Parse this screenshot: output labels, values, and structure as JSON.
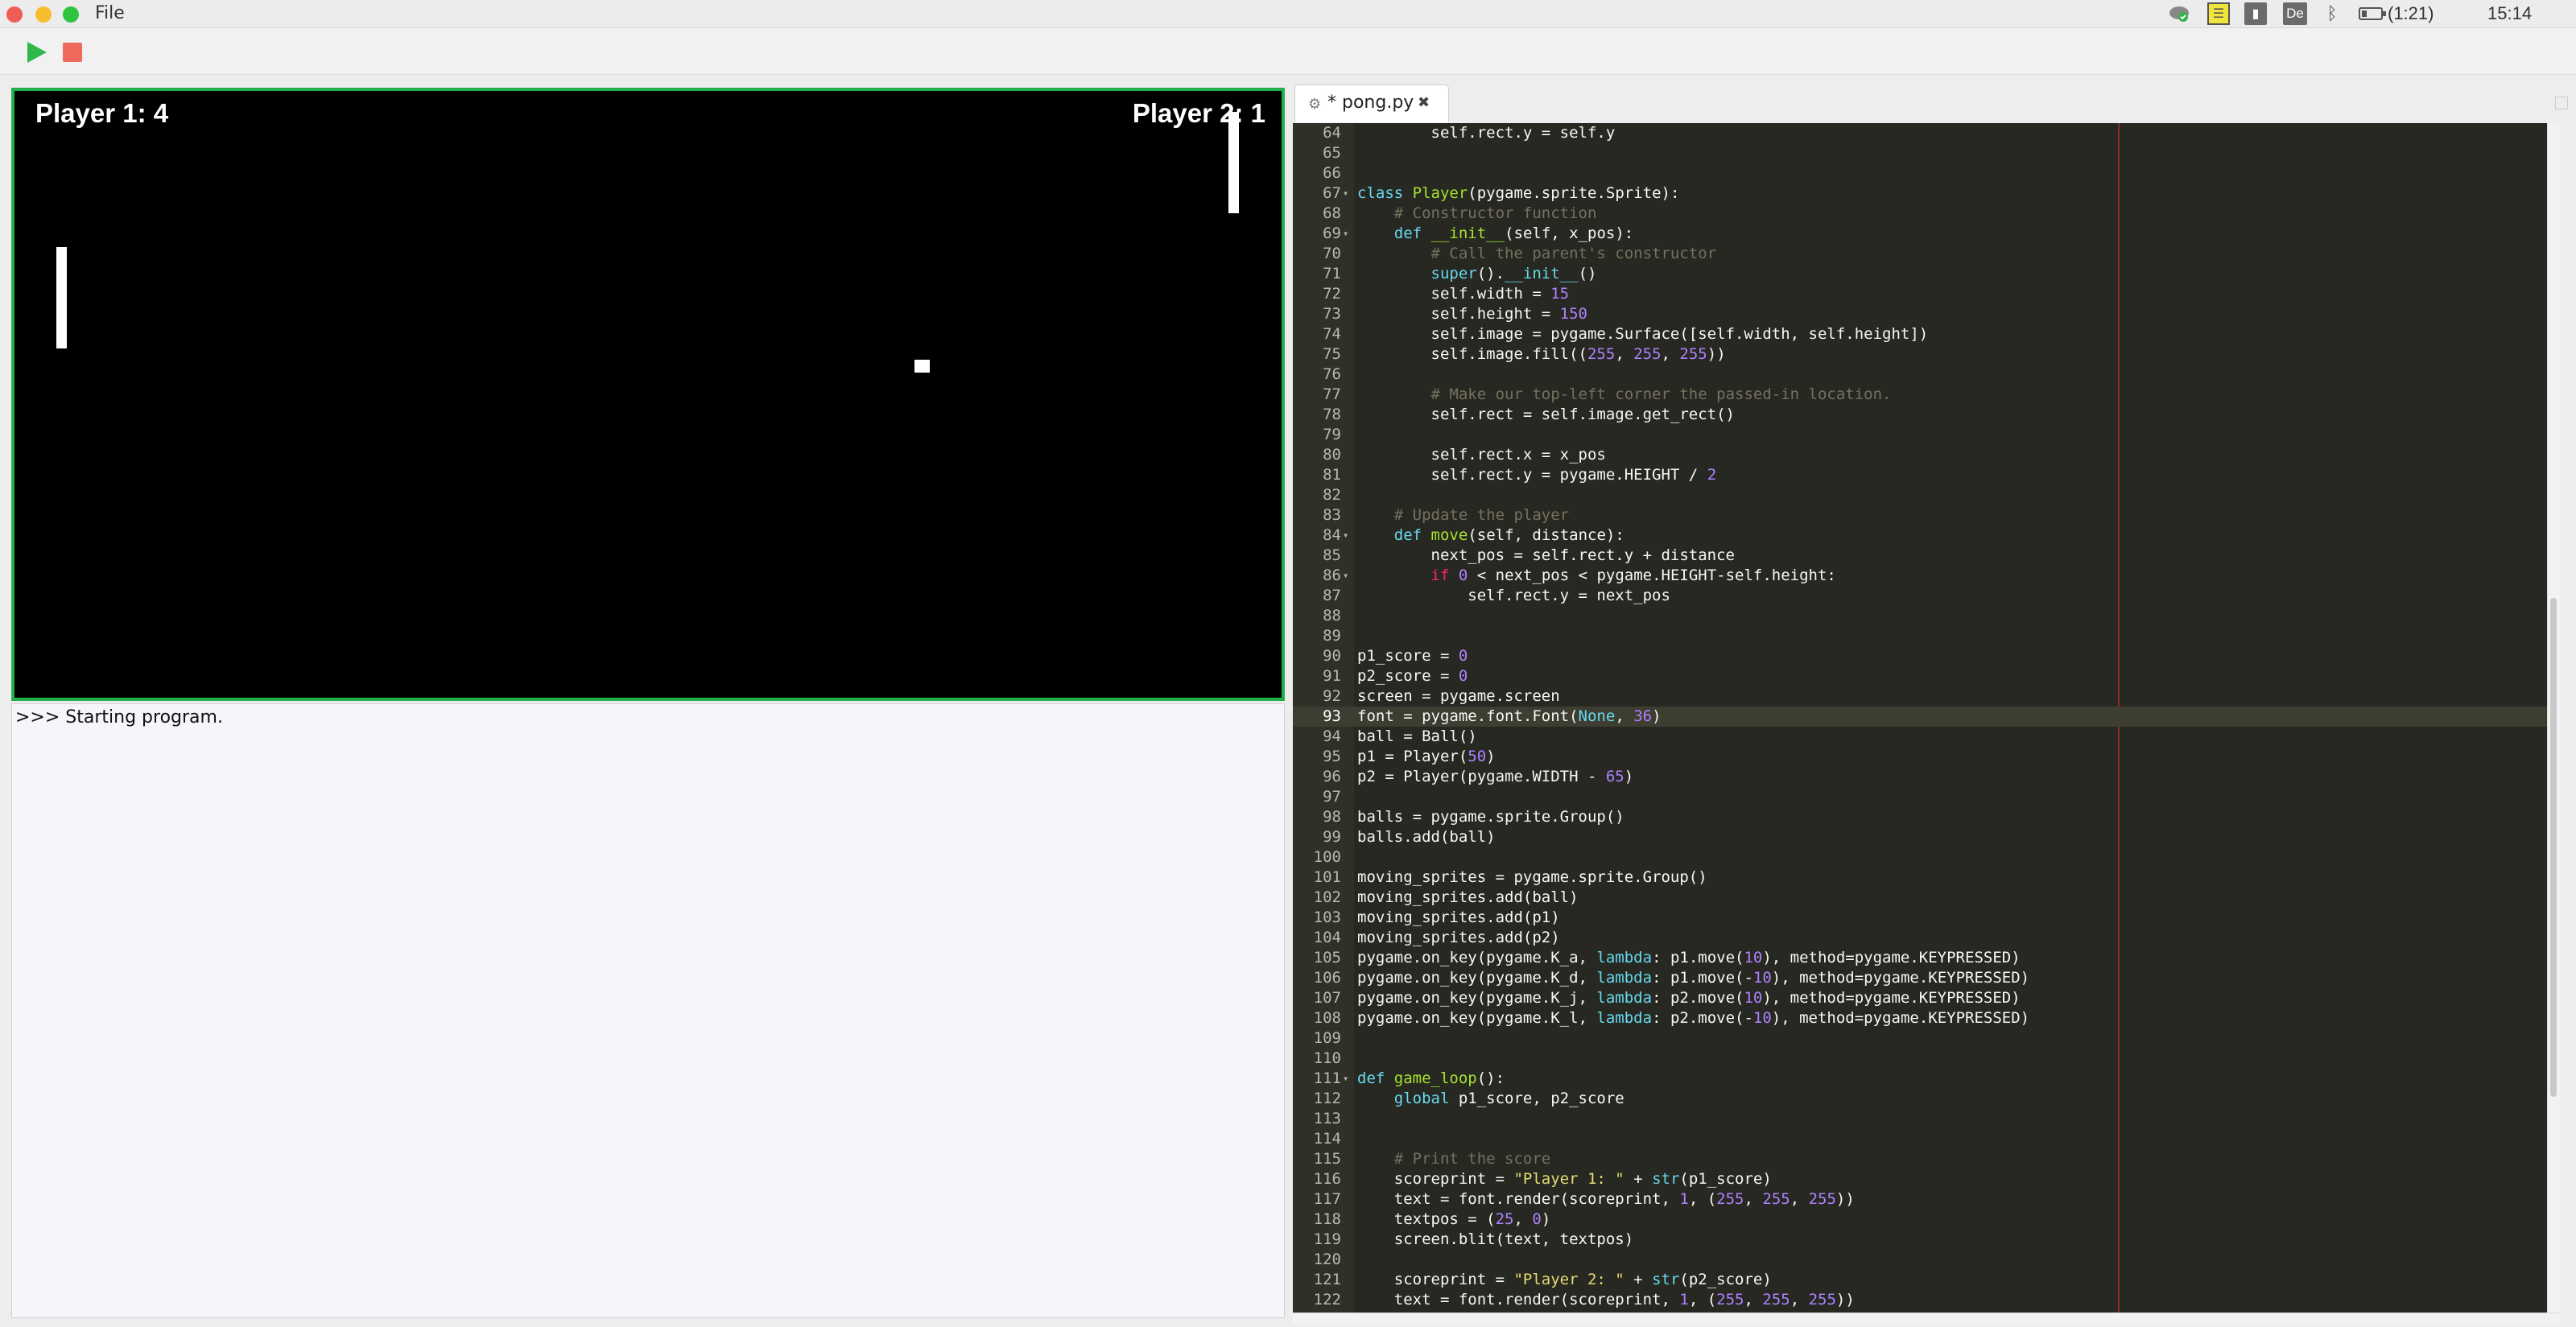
{
  "menubar": {
    "menu_file": "File",
    "tray_lang": "De",
    "battery_text": "(1:21)",
    "clock": "15:14"
  },
  "icons": {
    "cloud": "cloud-sync-icon",
    "notes": "sticky-notes-icon",
    "chart": "system-monitor-icon",
    "bluetooth": "bluetooth-icon",
    "battery": "battery-icon",
    "apple": "apple-logo-icon",
    "run": "play-icon",
    "stop": "stop-icon"
  },
  "colors": {
    "run": "#2eb84b",
    "stop": "#ef6a5c",
    "game_border": "#22b04b",
    "editor_bg": "#272822"
  },
  "game": {
    "score_left": "Player 1: 4",
    "score_right": "Player 2: 1"
  },
  "console": {
    "output": ">>> Starting program."
  },
  "editor": {
    "tab_label": "* pong.py",
    "current_line": 93,
    "lines": [
      {
        "n": 64,
        "t": "        self.rect.y = self.y"
      },
      {
        "n": 65,
        "t": ""
      },
      {
        "n": 66,
        "t": ""
      },
      {
        "n": 67,
        "t": "class Player(pygame.sprite.Sprite):",
        "fold": true
      },
      {
        "n": 68,
        "t": "    # Constructor function"
      },
      {
        "n": 69,
        "t": "    def __init__(self, x_pos):",
        "fold": true
      },
      {
        "n": 70,
        "t": "        # Call the parent's constructor"
      },
      {
        "n": 71,
        "t": "        super().__init__()"
      },
      {
        "n": 72,
        "t": "        self.width = 15"
      },
      {
        "n": 73,
        "t": "        self.height = 150"
      },
      {
        "n": 74,
        "t": "        self.image = pygame.Surface([self.width, self.height])"
      },
      {
        "n": 75,
        "t": "        self.image.fill((255, 255, 255))"
      },
      {
        "n": 76,
        "t": ""
      },
      {
        "n": 77,
        "t": "        # Make our top-left corner the passed-in location."
      },
      {
        "n": 78,
        "t": "        self.rect = self.image.get_rect()"
      },
      {
        "n": 79,
        "t": ""
      },
      {
        "n": 80,
        "t": "        self.rect.x = x_pos"
      },
      {
        "n": 81,
        "t": "        self.rect.y = pygame.HEIGHT / 2"
      },
      {
        "n": 82,
        "t": ""
      },
      {
        "n": 83,
        "t": "    # Update the player"
      },
      {
        "n": 84,
        "t": "    def move(self, distance):",
        "fold": true
      },
      {
        "n": 85,
        "t": "        next_pos = self.rect.y + distance"
      },
      {
        "n": 86,
        "t": "        if 0 < next_pos < pygame.HEIGHT-self.height:",
        "fold": true
      },
      {
        "n": 87,
        "t": "            self.rect.y = next_pos"
      },
      {
        "n": 88,
        "t": ""
      },
      {
        "n": 89,
        "t": ""
      },
      {
        "n": 90,
        "t": "p1_score = 0"
      },
      {
        "n": 91,
        "t": "p2_score = 0"
      },
      {
        "n": 92,
        "t": "screen = pygame.screen"
      },
      {
        "n": 93,
        "t": "font = pygame.font.Font(None, 36)"
      },
      {
        "n": 94,
        "t": "ball = Ball()"
      },
      {
        "n": 95,
        "t": "p1 = Player(50)"
      },
      {
        "n": 96,
        "t": "p2 = Player(pygame.WIDTH - 65)"
      },
      {
        "n": 97,
        "t": ""
      },
      {
        "n": 98,
        "t": "balls = pygame.sprite.Group()"
      },
      {
        "n": 99,
        "t": "balls.add(ball)"
      },
      {
        "n": 100,
        "t": ""
      },
      {
        "n": 101,
        "t": "moving_sprites = pygame.sprite.Group()"
      },
      {
        "n": 102,
        "t": "moving_sprites.add(ball)"
      },
      {
        "n": 103,
        "t": "moving_sprites.add(p1)"
      },
      {
        "n": 104,
        "t": "moving_sprites.add(p2)"
      },
      {
        "n": 105,
        "t": "pygame.on_key(pygame.K_a, lambda: p1.move(10), method=pygame.KEYPRESSED)"
      },
      {
        "n": 106,
        "t": "pygame.on_key(pygame.K_d, lambda: p1.move(-10), method=pygame.KEYPRESSED)"
      },
      {
        "n": 107,
        "t": "pygame.on_key(pygame.K_j, lambda: p2.move(10), method=pygame.KEYPRESSED)"
      },
      {
        "n": 108,
        "t": "pygame.on_key(pygame.K_l, lambda: p2.move(-10), method=pygame.KEYPRESSED)"
      },
      {
        "n": 109,
        "t": ""
      },
      {
        "n": 110,
        "t": ""
      },
      {
        "n": 111,
        "t": "def game_loop():",
        "fold": true
      },
      {
        "n": 112,
        "t": "    global p1_score, p2_score"
      },
      {
        "n": 113,
        "t": ""
      },
      {
        "n": 114,
        "t": ""
      },
      {
        "n": 115,
        "t": "    # Print the score"
      },
      {
        "n": 116,
        "t": "    scoreprint = \"Player 1: \" + str(p1_score)"
      },
      {
        "n": 117,
        "t": "    text = font.render(scoreprint, 1, (255, 255, 255))"
      },
      {
        "n": 118,
        "t": "    textpos = (25, 0)"
      },
      {
        "n": 119,
        "t": "    screen.blit(text, textpos)"
      },
      {
        "n": 120,
        "t": ""
      },
      {
        "n": 121,
        "t": "    scoreprint = \"Player 2: \" + str(p2_score)"
      },
      {
        "n": 122,
        "t": "    text = font.render(scoreprint, 1, (255, 255, 255))"
      }
    ]
  }
}
